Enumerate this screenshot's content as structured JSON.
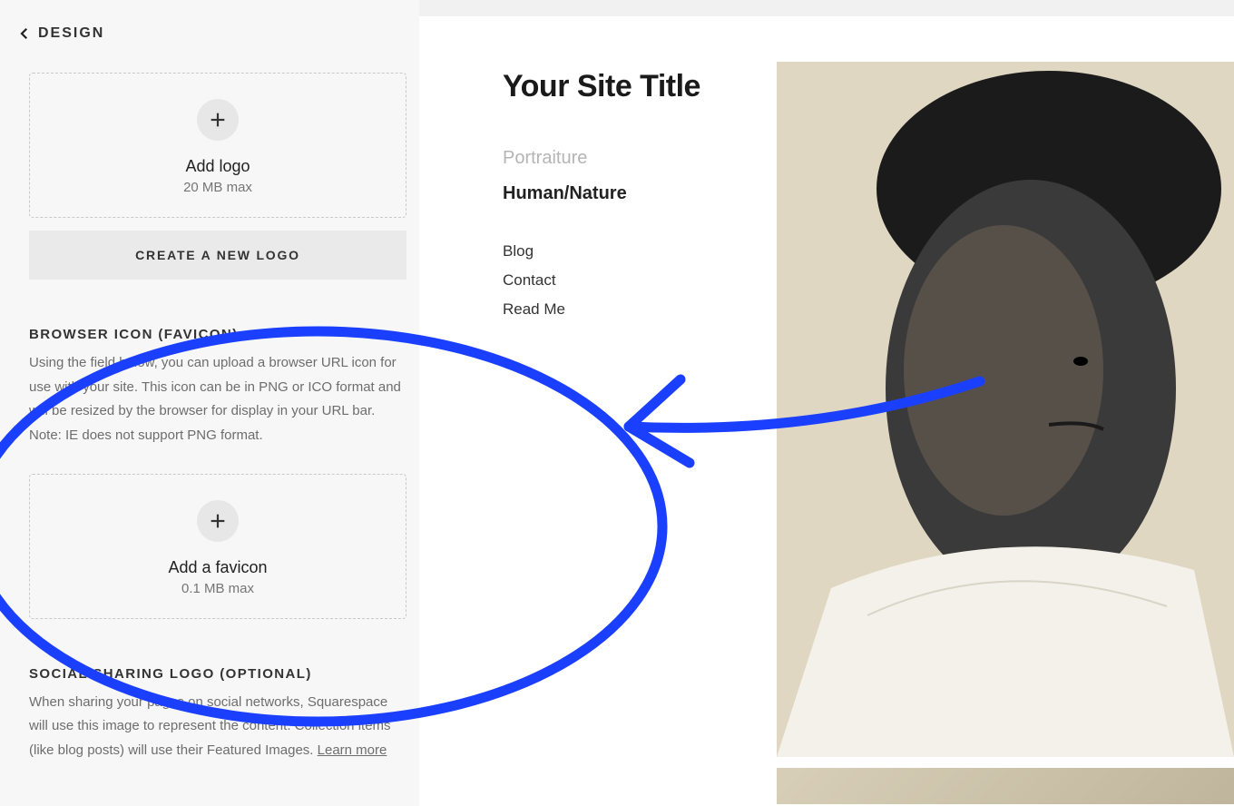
{
  "sidebar": {
    "back_label": "DESIGN",
    "logo_box": {
      "title": "Add logo",
      "subtitle": "20 MB max"
    },
    "create_logo_button": "CREATE A NEW LOGO",
    "favicon_section": {
      "title": "BROWSER ICON (FAVICON)",
      "desc": "Using the field below, you can upload a browser URL icon for use with your site. This icon can be in PNG or ICO format and will be resized by the browser for display in your URL bar. Note: IE does not support PNG format."
    },
    "favicon_box": {
      "title": "Add a favicon",
      "subtitle": "0.1 MB max"
    },
    "social_section": {
      "title": "SOCIAL SHARING LOGO (OPTIONAL)",
      "desc": "When sharing your pages on social networks, Squarespace will use this image to represent the content. Collection items (like blog posts) will use their Featured Images. ",
      "learn_more": "Learn more"
    }
  },
  "preview": {
    "site_title": "Your Site Title",
    "nav": {
      "muted": "Portraiture",
      "bold": "Human/Nature",
      "items": [
        "Blog",
        "Contact",
        "Read Me"
      ]
    }
  }
}
